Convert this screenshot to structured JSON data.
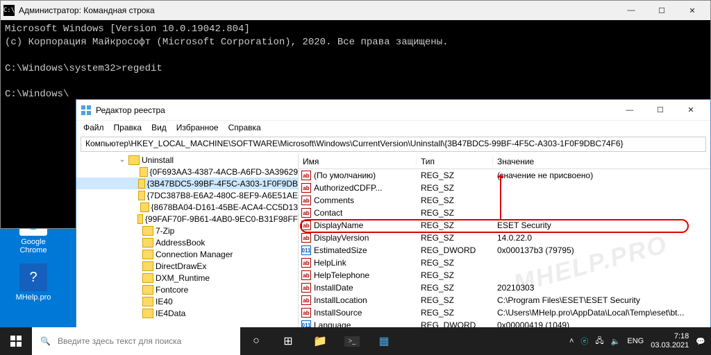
{
  "desktop": {
    "chrome": "Google\nChrome",
    "mhelp": "MHelp.pro"
  },
  "cmd": {
    "title": "Администратор: Командная строка",
    "body": "Microsoft Windows [Version 10.0.19042.804]\n(c) Корпорация Майкрософт (Microsoft Corporation), 2020. Все права защищены.\n\nC:\\Windows\\system32>regedit\n\nC:\\Windows\\"
  },
  "reg": {
    "title": "Редактор реестра",
    "menu": [
      "Файл",
      "Правка",
      "Вид",
      "Избранное",
      "Справка"
    ],
    "path": "Компьютер\\HKEY_LOCAL_MACHINE\\SOFTWARE\\Microsoft\\Windows\\CurrentVersion\\Uninstall\\{3B47BDC5-99BF-4F5C-A303-1F0F9DBC74F6}",
    "tree_top": "Uninstall",
    "tree": [
      "{0F693AA3-4387-4ACB-A6FD-3A39629",
      "{3B47BDC5-99BF-4F5C-A303-1F0F9DB",
      "{7DC387B8-E6A2-480C-8EF9-A6E51AE",
      "{8678BA04-D161-45BE-ACA4-CC5D13",
      "{99FAF70F-9B61-4AB0-9EC0-B31F98FF",
      "7-Zip",
      "AddressBook",
      "Connection Manager",
      "DirectDrawEx",
      "DXM_Runtime",
      "Fontcore",
      "IE40",
      "IE4Data"
    ],
    "selected_index": 1,
    "cols": {
      "name": "Имя",
      "type": "Тип",
      "val": "Значение"
    },
    "rows": [
      {
        "name": "(По умолчанию)",
        "type": "REG_SZ",
        "val": "(значение не присвоено)",
        "k": "sz"
      },
      {
        "name": "AuthorizedCDFP...",
        "type": "REG_SZ",
        "val": "",
        "k": "sz"
      },
      {
        "name": "Comments",
        "type": "REG_SZ",
        "val": "",
        "k": "sz"
      },
      {
        "name": "Contact",
        "type": "REG_SZ",
        "val": "",
        "k": "sz"
      },
      {
        "name": "DisplayName",
        "type": "REG_SZ",
        "val": "ESET Security",
        "k": "sz"
      },
      {
        "name": "DisplayVersion",
        "type": "REG_SZ",
        "val": "14.0.22.0",
        "k": "sz"
      },
      {
        "name": "EstimatedSize",
        "type": "REG_DWORD",
        "val": "0x000137b3 (79795)",
        "k": "dw"
      },
      {
        "name": "HelpLink",
        "type": "REG_SZ",
        "val": "",
        "k": "sz"
      },
      {
        "name": "HelpTelephone",
        "type": "REG_SZ",
        "val": "",
        "k": "sz"
      },
      {
        "name": "InstallDate",
        "type": "REG_SZ",
        "val": "20210303",
        "k": "sz"
      },
      {
        "name": "InstallLocation",
        "type": "REG_SZ",
        "val": "C:\\Program Files\\ESET\\ESET Security",
        "k": "sz"
      },
      {
        "name": "InstallSource",
        "type": "REG_SZ",
        "val": "C:\\Users\\MHelp.pro\\AppData\\Local\\Temp\\eset\\bt...",
        "k": "sz"
      },
      {
        "name": "Language",
        "type": "REG_DWORD",
        "val": "0x00000419 (1049)",
        "k": "dw"
      }
    ]
  },
  "taskbar": {
    "search_placeholder": "Введите здесь текст для поиска",
    "lang": "ENG",
    "time": "7:18",
    "date": "03.03.2021"
  },
  "watermark": "MHELP.PRO"
}
